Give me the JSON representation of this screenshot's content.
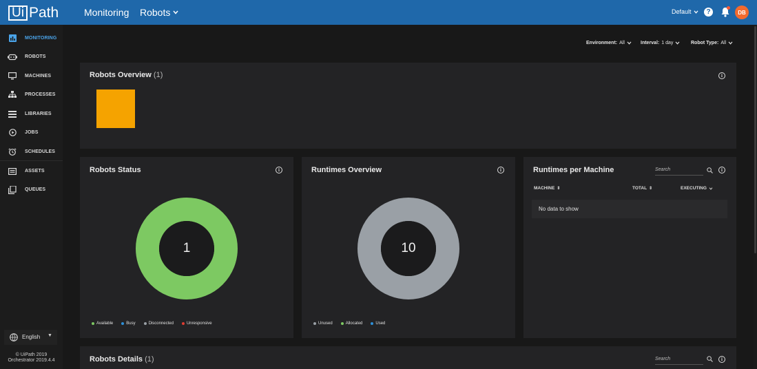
{
  "header": {
    "logo_boxed": "Ui",
    "logo_rest": "Path",
    "section": "Monitoring",
    "subsection": "Robots",
    "tenant": "Default",
    "avatar": "DB"
  },
  "sidebar": {
    "items": [
      {
        "label": "MONITORING",
        "icon": "monitoring-icon"
      },
      {
        "label": "ROBOTS",
        "icon": "robot-icon"
      },
      {
        "label": "MACHINES",
        "icon": "monitor-icon"
      },
      {
        "label": "PROCESSES",
        "icon": "process-tree-icon"
      },
      {
        "label": "LIBRARIES",
        "icon": "library-icon"
      },
      {
        "label": "JOBS",
        "icon": "play-circle-icon"
      },
      {
        "label": "SCHEDULES",
        "icon": "alarm-clock-icon"
      },
      {
        "label": "ASSETS",
        "icon": "asset-icon"
      },
      {
        "label": "QUEUES",
        "icon": "queue-icon"
      }
    ],
    "language": "English",
    "copyright_line1": "© UiPath 2019",
    "copyright_line2": "Orchestrator 2019.4.4"
  },
  "filters": {
    "environment_label": "Environment:",
    "environment_value": "All",
    "interval_label": "Interval:",
    "interval_value": "1 day",
    "robot_type_label": "Robot Type:",
    "robot_type_value": "All"
  },
  "robots_overview": {
    "title": "Robots Overview",
    "count": "(1)",
    "tile_color": "#f5a300"
  },
  "robots_status": {
    "title": "Robots Status",
    "total": "1",
    "legend": [
      {
        "label": "Available",
        "color": "#7dc962"
      },
      {
        "label": "Busy",
        "color": "#2e8fd8"
      },
      {
        "label": "Disconnected",
        "color": "#9aa0a6"
      },
      {
        "label": "Unresponsive",
        "color": "#e03c31"
      }
    ]
  },
  "runtimes_overview": {
    "title": "Runtimes Overview",
    "total": "10",
    "legend": [
      {
        "label": "Unused",
        "color": "#9aa0a6"
      },
      {
        "label": "Allocated",
        "color": "#7dc962"
      },
      {
        "label": "Used",
        "color": "#2e8fd8"
      }
    ]
  },
  "runtimes_per_machine": {
    "title": "Runtimes per Machine",
    "search_placeholder": "Search",
    "columns": [
      "MACHINE",
      "TOTAL",
      "EXECUTING"
    ],
    "empty_text": "No data to show"
  },
  "robots_details": {
    "title": "Robots Details",
    "count": "(1)",
    "search_placeholder": "Search"
  },
  "chart_data": [
    {
      "type": "pie",
      "title": "Robots Status",
      "categories": [
        "Available",
        "Busy",
        "Disconnected",
        "Unresponsive"
      ],
      "values": [
        1,
        0,
        0,
        0
      ],
      "total": 1
    },
    {
      "type": "pie",
      "title": "Runtimes Overview",
      "categories": [
        "Unused",
        "Allocated",
        "Used"
      ],
      "values": [
        10,
        0,
        0
      ],
      "total": 10
    }
  ]
}
